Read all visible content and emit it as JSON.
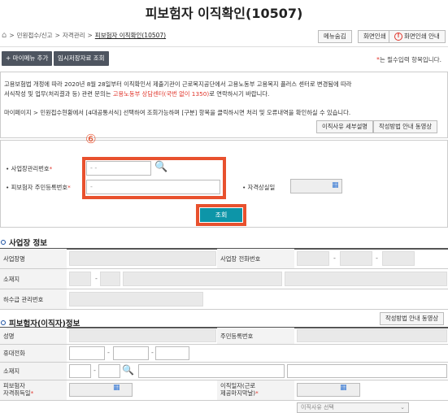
{
  "page": {
    "title": "피보험자 이직확인(10507)"
  },
  "breadcrumb": {
    "items": [
      "민원접수/신고",
      "자격관리",
      "피보험자 이직확인(10507)"
    ],
    "sep": ">"
  },
  "top_buttons": {
    "menu_hide": "메뉴숨김",
    "print": "화면인쇄",
    "print_guide": "화면인쇄 안내"
  },
  "actions": {
    "add_my_menu": "+ 마이메뉴 추가",
    "temp_saved": "임시저장자료 조회"
  },
  "required_note": {
    "star": "*",
    "text": "는 필수입력 항목입니다."
  },
  "notice": {
    "line1": "고용보험법 개정에 따라 2020년 8월 28일부터 이직확인서 제출기관이 근로복지공단에서 고용노동부 고용복지 플러스 센터로 변경됨에 따라",
    "line2a": "서식작성 및 업무(처리결과 등) 관련 문의는 ",
    "line2b": "고용노동부 상담센터(국번 없이 1350)",
    "line2c": "로 연락하시기 바랍니다.",
    "line3": "마이페이지 > 민원접수현황에서 [4대공통서식] 선택하여 조회가능하며 [구분] 항목을 클릭하시면 처리 및 오류내역을 확인하실 수 있습니다.",
    "btn_reason": "이직사유 세부설명",
    "btn_video": "작성방법 안내 동영상"
  },
  "search": {
    "annotation": "⑥",
    "biz_label": "사업장관리번호",
    "biz_value": "-   -",
    "person_label": "피보험자 주민등록번호",
    "person_value": "-",
    "loss_date_label": "자격상실일",
    "search_btn": "조회",
    "star": "*"
  },
  "biz_info": {
    "title": "사업장 정보",
    "name_label": "사업장명",
    "phone_label": "사업장 전화번호",
    "address_label": "소재지",
    "sub_label": "하수급 관리번호"
  },
  "person_info": {
    "title": "피보험자(이직자)정보",
    "video_btn": "작성방법 안내 동영상",
    "name_label": "성명",
    "rrn_label": "주민등록번호",
    "mobile_label": "휴대전화",
    "address_label": "소재지",
    "acq_label_1": "피보험자",
    "acq_label_2": "자격취득일",
    "leave_label_1": "이직일자(근로",
    "leave_label_2": "제공마지막날)",
    "reason_select": "이직사유 선택",
    "star": "*"
  },
  "colors": {
    "accent": "#0d95a8",
    "highlight": "#e8512e",
    "required": "#e0352b"
  }
}
